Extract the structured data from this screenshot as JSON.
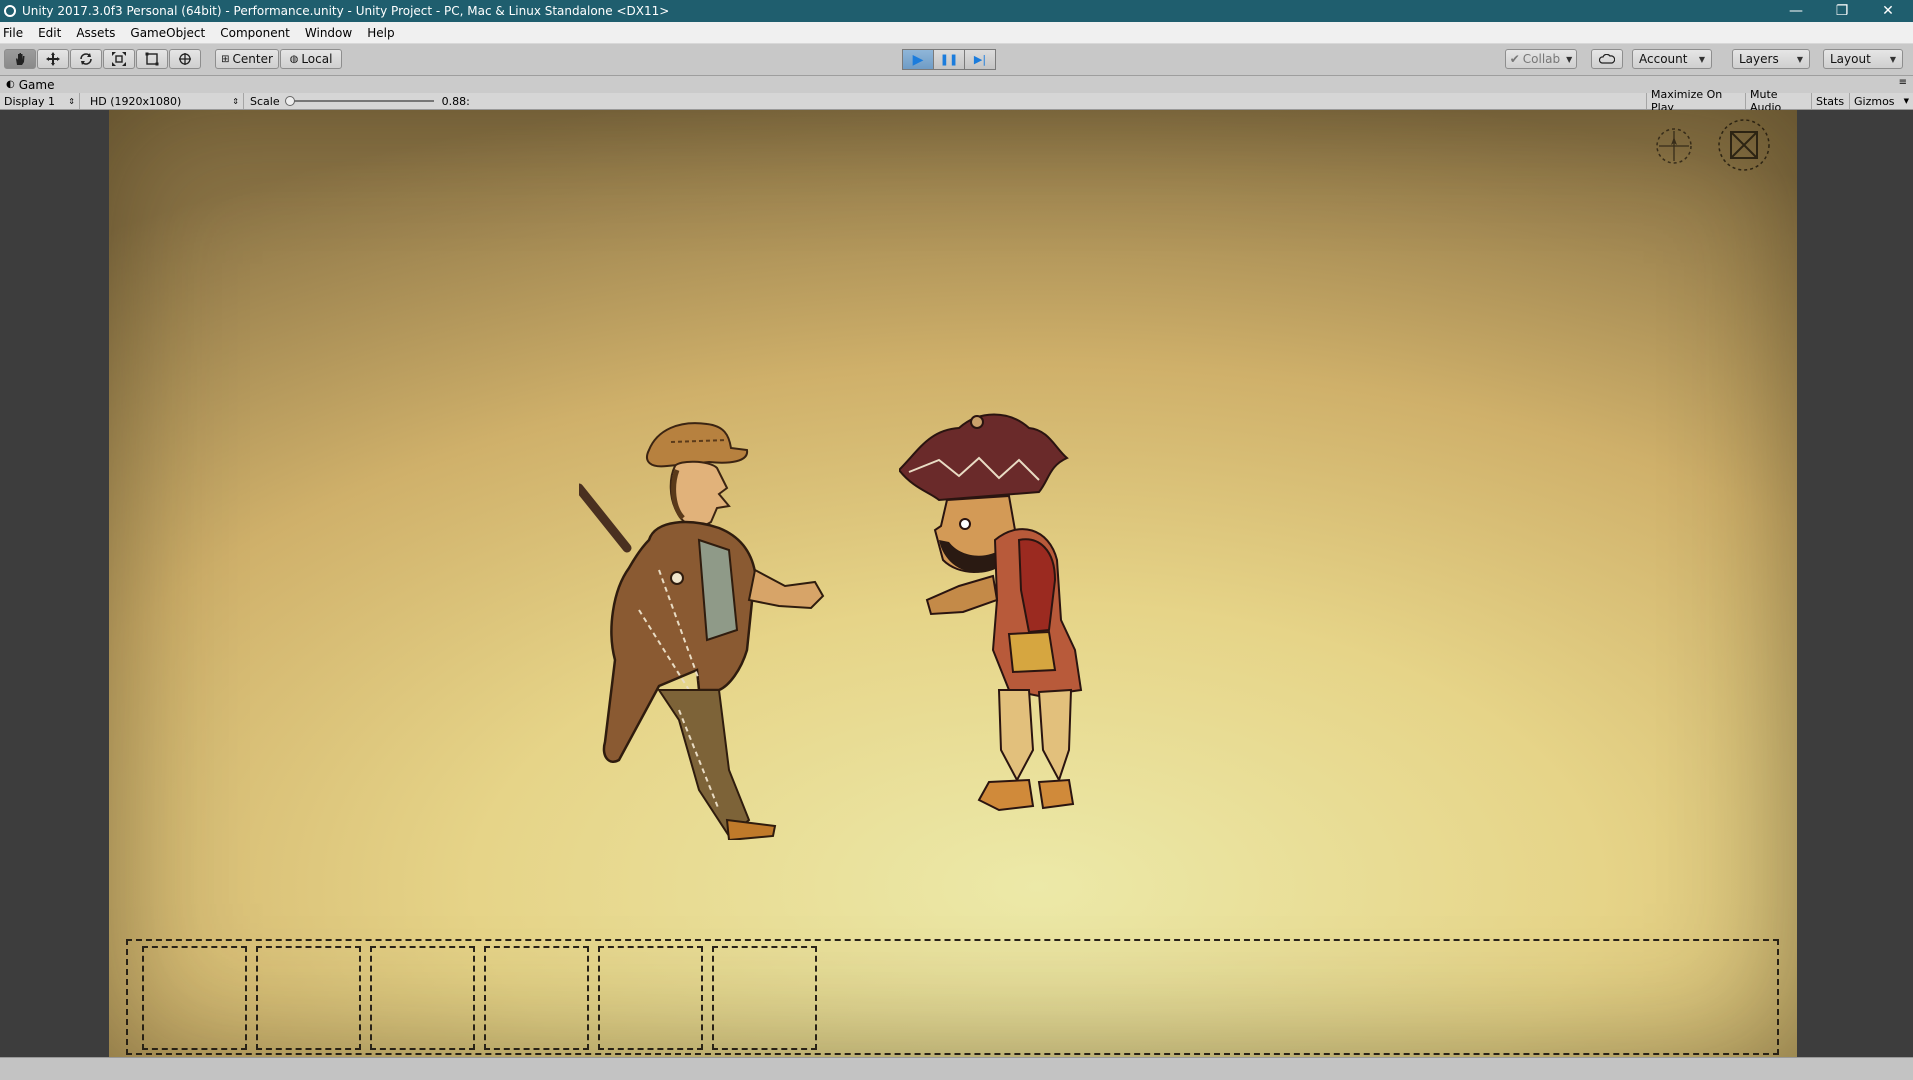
{
  "window": {
    "title": "Unity 2017.3.0f3 Personal (64bit) - Performance.unity - Unity Project - PC, Mac & Linux Standalone <DX11>",
    "controls": {
      "minimize": "—",
      "restore": "❐",
      "close": "✕"
    }
  },
  "menu": [
    "File",
    "Edit",
    "Assets",
    "GameObject",
    "Component",
    "Window",
    "Help"
  ],
  "toolbar": {
    "tools": [
      "hand-tool",
      "move-tool",
      "rotate-tool",
      "scale-tool",
      "rect-tool",
      "transform-tool"
    ],
    "pivot_label": "Center",
    "space_label": "Local",
    "play_icon": "▶",
    "pause_icon": "❚❚",
    "step_icon": "▶|",
    "collab_label": "Collab",
    "account_label": "Account",
    "layers_label": "Layers",
    "layout_label": "Layout"
  },
  "game_view": {
    "tab_label": "Game",
    "display_label": "Display 1",
    "resolution_label": "HD (1920x1080)",
    "scale_label": "Scale",
    "scale_value": "0.88:",
    "toggles": [
      "Maximize On Play",
      "Mute Audio",
      "Stats",
      "Gizmos"
    ]
  },
  "colors": {
    "titlebar": "#1f5e6e",
    "play_active": "#1b7cdc",
    "stage_light": "#ece9a8",
    "stage_dark": "#8b7446",
    "viewport_bg": "#3d3d3d"
  },
  "stage": {
    "hud_icons": [
      "compass-icon",
      "fullscreen-icon"
    ],
    "figures": [
      "puppet-figure-gentleman",
      "puppet-figure-karagoz"
    ],
    "slot_count": 6
  }
}
